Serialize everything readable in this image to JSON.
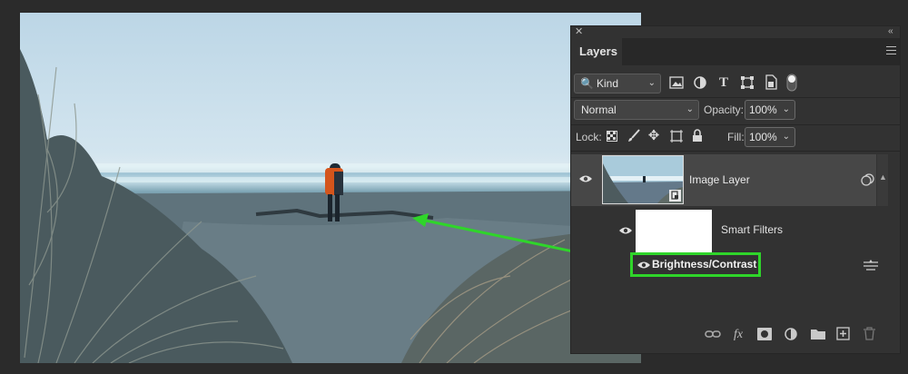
{
  "panel": {
    "tab_label": "Layers",
    "close_glyph": "✕",
    "collapse_glyph": "‹‹"
  },
  "filter": {
    "kind_label": "Kind",
    "icons": [
      "image-filter-icon",
      "adjustment-filter-icon",
      "type-filter-icon",
      "shape-filter-icon",
      "smart-object-filter-icon",
      "filter-toggle-icon"
    ]
  },
  "blend": {
    "mode": "Normal",
    "opacity_label": "Opacity:",
    "opacity_value": "100%"
  },
  "lock": {
    "label": "Lock:",
    "fill_label": "Fill:",
    "fill_value": "100%"
  },
  "layers": {
    "image_layer_name": "Image Layer",
    "smart_filters_label": "Smart Filters",
    "filter_name": "Brightness/Contrast"
  },
  "colors": {
    "highlight": "#2fd52a",
    "arrow": "#2fd52a",
    "panel_bg": "#323232",
    "selected_row": "#474747"
  }
}
